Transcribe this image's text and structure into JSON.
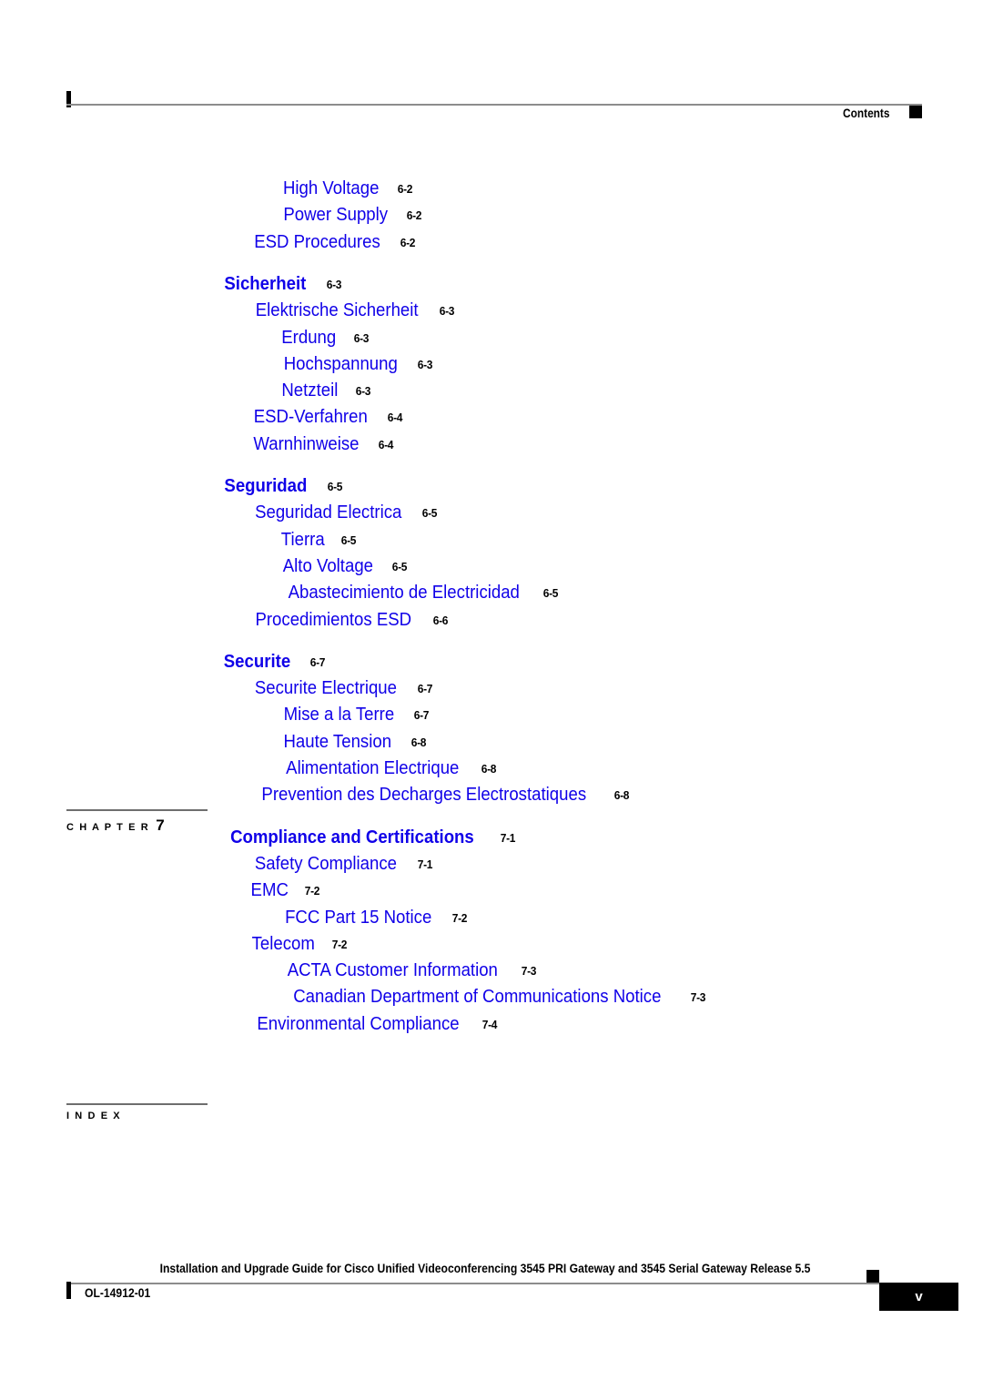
{
  "header": {
    "label": "Contents",
    "marker_icon": "black-square-marker"
  },
  "toc": {
    "entries": [
      {
        "title": "High Voltage",
        "page": "6-2",
        "level": 3
      },
      {
        "title": "Power Supply",
        "page": "6-2",
        "level": 3
      },
      {
        "title": "ESD Procedures",
        "page": "6-2",
        "level": 2
      },
      {
        "title": "Sicherheit",
        "page": "6-3",
        "level": 1,
        "gap": true
      },
      {
        "title": "Elektrische Sicherheit",
        "page": "6-3",
        "level": 2
      },
      {
        "title": "Erdung",
        "page": "6-3",
        "level": 3
      },
      {
        "title": "Hochspannung",
        "page": "6-3",
        "level": 3
      },
      {
        "title": "Netzteil",
        "page": "6-3",
        "level": 3
      },
      {
        "title": "ESD-Verfahren",
        "page": "6-4",
        "level": 2
      },
      {
        "title": "Warnhinweise",
        "page": "6-4",
        "level": 2
      },
      {
        "title": "Seguridad",
        "page": "6-5",
        "level": 1,
        "gap": true
      },
      {
        "title": "Seguridad Electrica",
        "page": "6-5",
        "level": 2
      },
      {
        "title": "Tierra",
        "page": "6-5",
        "level": 3
      },
      {
        "title": "Alto Voltage",
        "page": "6-5",
        "level": 3
      },
      {
        "title": "Abastecimiento de Electricidad",
        "page": "6-5",
        "level": 3
      },
      {
        "title": "Procedimientos ESD",
        "page": "6-6",
        "level": 2
      },
      {
        "title": "Securite",
        "page": "6-7",
        "level": 1,
        "gap": true
      },
      {
        "title": "Securite Electrique",
        "page": "6-7",
        "level": 2
      },
      {
        "title": "Mise a la Terre",
        "page": "6-7",
        "level": 3
      },
      {
        "title": "Haute Tension",
        "page": "6-8",
        "level": 3
      },
      {
        "title": "Alimentation Electrique",
        "page": "6-8",
        "level": 3
      },
      {
        "title": "Prevention des Decharges Electrostatiques",
        "page": "6-8",
        "level": 2
      },
      {
        "title": "Compliance and Certifications",
        "page": "7-1",
        "level": 1,
        "gap": true,
        "chapter_marker": {
          "label": "C H A P T E R",
          "number": "7"
        }
      },
      {
        "title": "Safety Compliance",
        "page": "7-1",
        "level": 2
      },
      {
        "title": "EMC",
        "page": "7-2",
        "level": 2
      },
      {
        "title": "FCC Part 15 Notice",
        "page": "7-2",
        "level": 3
      },
      {
        "title": "Telecom",
        "page": "7-2",
        "level": 2
      },
      {
        "title": "ACTA Customer Information",
        "page": "7-3",
        "level": 3
      },
      {
        "title": "Canadian Department of Communications Notice",
        "page": "7-3",
        "level": 3
      },
      {
        "title": "Environmental Compliance",
        "page": "7-4",
        "level": 2
      }
    ]
  },
  "index_marker": {
    "label": "I N D E X"
  },
  "footer": {
    "title": "Installation and Upgrade Guide for Cisco Unified Videoconferencing 3545 PRI Gateway and 3545 Serial Gateway Release 5.5",
    "doc_id": "OL-14912-01",
    "page_number": "v",
    "marker_icon": "black-square-marker"
  },
  "colors": {
    "link_blue": "#1000e8",
    "rule_gray": "#8c8c8c",
    "text_black": "#000000",
    "page_white": "#ffffff"
  }
}
